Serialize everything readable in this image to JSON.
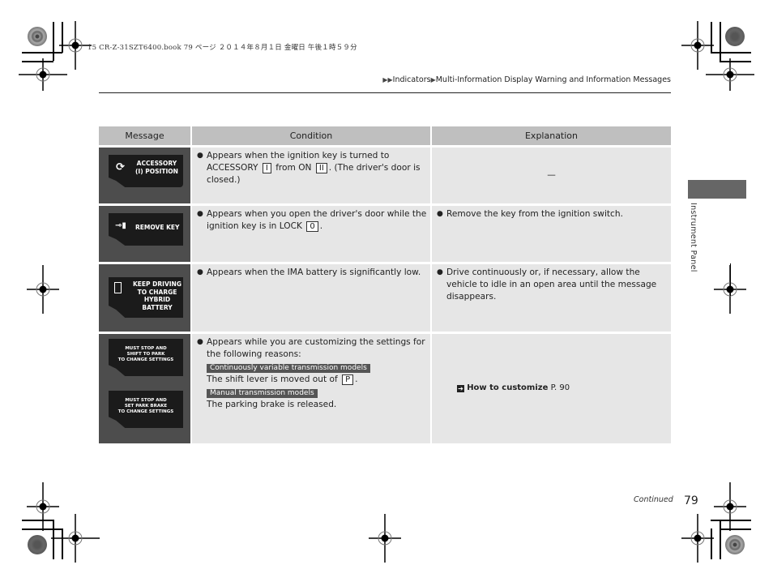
{
  "print_header": "15 CR-Z-31SZT6400.book  79 ページ  ２０１４年８月１日  金曜日  午後１時５９分",
  "breadcrumb": {
    "arrows": "▶▶",
    "level1": "Indicators",
    "separator": "▶",
    "level2": "Multi-Information Display Warning and Information Messages"
  },
  "table": {
    "headers": [
      "Message",
      "Condition",
      "Explanation"
    ],
    "rows": [
      {
        "display": {
          "icon": "key-accessory-icon",
          "lines": [
            "ACCESSORY",
            "(I) POSITION"
          ]
        },
        "condition": {
          "bullet_pre": "Appears when the ignition key is turned to ACCESSORY",
          "key1": "I",
          "mid": "from ON",
          "key2": "II",
          "post": ". (The driver's door is closed.)"
        },
        "explanation": "—"
      },
      {
        "display": {
          "icon": "key-remove-icon",
          "lines": [
            "REMOVE KEY"
          ]
        },
        "condition": {
          "bullet_pre": "Appears when you open the driver's door while the ignition key is in LOCK",
          "key1": "0",
          "post": "."
        },
        "explanation": "Remove the key from the ignition switch."
      },
      {
        "display": {
          "icon": "battery-icon",
          "lines": [
            "KEEP DRIVING",
            "TO CHARGE",
            "HYBRID",
            "BATTERY"
          ]
        },
        "condition": {
          "bullet_pre": "Appears when the IMA battery is significantly low."
        },
        "explanation": "Drive continuously or, if necessary, allow the vehicle to idle in an open area until the message disappears."
      },
      {
        "display": {
          "screen1": [
            "MUST STOP AND",
            "SHIFT TO PARK",
            "TO CHANGE SETTINGS"
          ],
          "screen2": [
            "MUST STOP AND",
            "SET PARK BRAKE",
            "TO CHANGE SETTINGS"
          ]
        },
        "condition": {
          "bullet_pre": "Appears while you are customizing the settings for the following reasons:",
          "tag1": "Continuously variable transmission models",
          "text1_pre": "The shift lever is moved out of",
          "key1": "P",
          "text1_post": ".",
          "tag2": "Manual transmission models",
          "text2": "The parking brake is released."
        },
        "explanation": {
          "ref_icon": "reference-arrow-icon",
          "ref_bold": "How to customize",
          "ref_page": "P. 90"
        }
      }
    ]
  },
  "side_tab_label": "Instrument Panel",
  "footer": {
    "continued": "Continued",
    "page_number": "79"
  },
  "colors": {
    "header_bg": "#bfbfbf",
    "cell_bg": "#e6e6e6",
    "message_cell_bg": "#4d4d4d",
    "screen_bg": "#1b1b1b",
    "tag_bg": "#555555",
    "side_tab": "#666666"
  }
}
